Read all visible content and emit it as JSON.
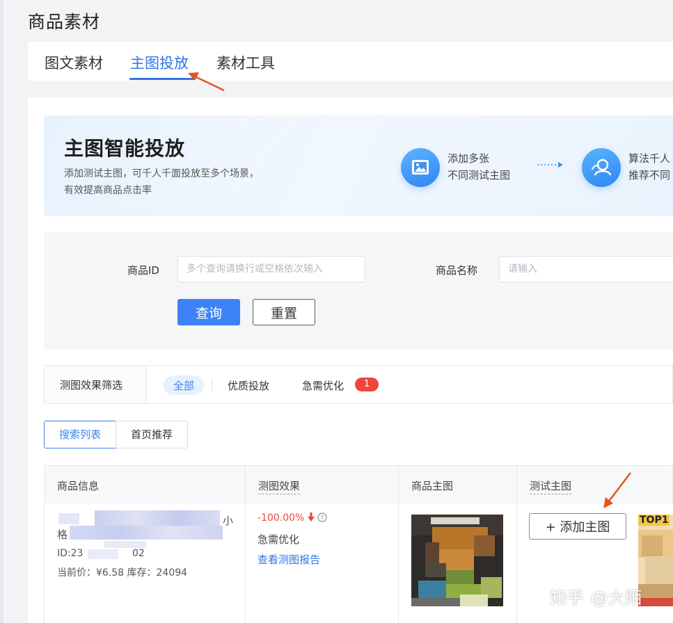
{
  "page": {
    "title": "商品素材"
  },
  "tabs": [
    {
      "label": "图文素材",
      "active": false
    },
    {
      "label": "主图投放",
      "active": true
    },
    {
      "label": "素材工具",
      "active": false
    }
  ],
  "banner": {
    "title": "主图智能投放",
    "desc_line1": "添加测试主图，可千人千面投放至多个场景，",
    "desc_line2": "有效提高商品点击率",
    "steps": [
      {
        "icon": "image-icon",
        "line1": "添加多张",
        "line2": "不同测试主图"
      },
      {
        "icon": "user-group-icon",
        "line1": "算法千人",
        "line2": "推荐不同"
      }
    ]
  },
  "search": {
    "product_id_label": "商品ID",
    "product_id_placeholder": "多个查询请换行或空格依次输入",
    "product_name_label": "商品名称",
    "product_name_placeholder": "请输入",
    "query_label": "查询",
    "reset_label": "重置"
  },
  "filter": {
    "title": "测图效果筛选",
    "options": [
      "全部",
      "优质投放",
      "急需优化"
    ],
    "selected": "全部",
    "urgent_count": "1"
  },
  "list_tabs": {
    "search_list": "搜索列表",
    "home_recommend": "首页推荐",
    "selected": "搜索列表"
  },
  "table": {
    "headers": [
      "商品信息",
      "测图效果",
      "商品主图",
      "测试主图"
    ],
    "rows": [
      {
        "title_tail_1": "小",
        "title_head_2": "格",
        "id_text": "ID:23",
        "id_tail": "02",
        "price_text": "当前价：¥6.58  库存：24094",
        "perf_value": "-100.00%",
        "perf_status": "急需优化",
        "report_link": "查看测图报告",
        "add_main_image": "+ 添加主图",
        "top_badge": "TOP1"
      }
    ]
  },
  "watermark": "知乎 @大陌",
  "colors": {
    "primary": "#2f75e8",
    "danger": "#f0453a",
    "annotation_arrow": "#e8541c"
  }
}
